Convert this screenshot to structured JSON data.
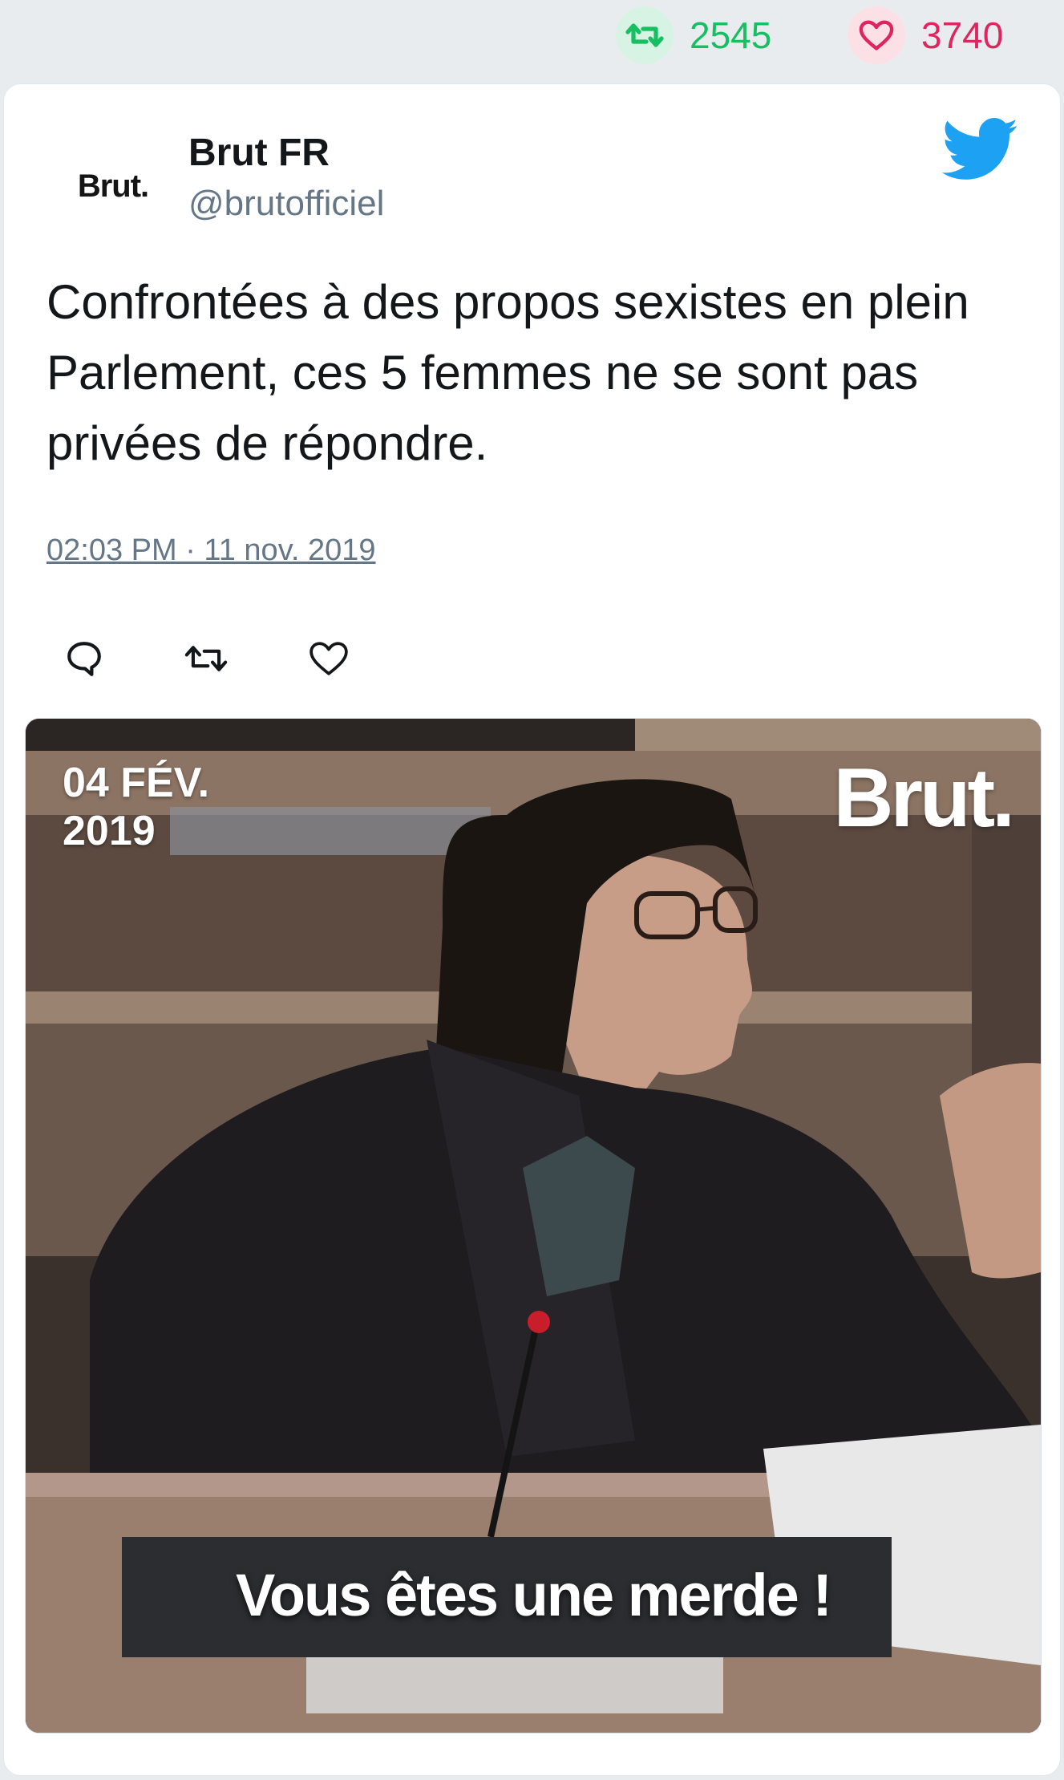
{
  "stats": {
    "retweets": "2545",
    "likes": "3740",
    "retweet_icon": "retweet-icon",
    "like_icon": "heart-icon"
  },
  "tweet": {
    "avatar_text": "Brut.",
    "display_name": "Brut FR",
    "handle": "@brutofficiel",
    "text": "Confrontées à des propos sexistes en plein Parlement, ces 5 femmes ne se sont pas privées de répondre.",
    "timestamp": "02:03 PM · 11 nov. 2019"
  },
  "actions": {
    "reply_icon": "reply-icon",
    "retweet_icon": "retweet-icon",
    "like_icon": "heart-icon"
  },
  "media": {
    "date_line1": "04 FÉV.",
    "date_line2": "2019",
    "logo": "Brut.",
    "subtitle": "Vous êtes une merde !"
  },
  "colors": {
    "retweet_green": "#17bf63",
    "like_red": "#e0245e",
    "twitter_blue": "#1da1f2",
    "text_gray": "#657786"
  }
}
